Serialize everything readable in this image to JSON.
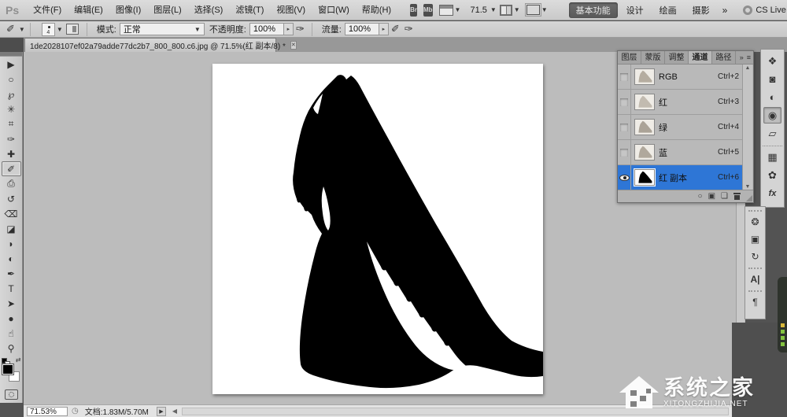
{
  "app": {
    "logo": "Ps",
    "menus": [
      "文件(F)",
      "编辑(E)",
      "图像(I)",
      "图层(L)",
      "选择(S)",
      "滤镜(T)",
      "视图(V)",
      "窗口(W)",
      "帮助(H)"
    ],
    "br_button": "Br",
    "mb_button": "Mb",
    "zoom_level": "71.5",
    "caret": "▼",
    "workspaces": [
      "基本功能",
      "设计",
      "绘画",
      "摄影"
    ],
    "workspace_more": "»",
    "cs_live": "CS Live",
    "window": {
      "minimize": "—",
      "restore": "❐",
      "close": "✕"
    }
  },
  "options_bar": {
    "brush_icon": "✐",
    "brush_size": "4",
    "mode_label": "模式:",
    "mode_value": "正常",
    "opacity_label": "不透明度:",
    "opacity_value": "100%",
    "spin": "▸",
    "airbrush_icon": "✐",
    "flow_label": "流量:",
    "flow_value": "100%",
    "pressure_icon": "✑"
  },
  "document": {
    "tab_title": "1de2028107ef02a79adde77dc2b7_800_800.c6.jpg @ 71.5%(红 副本/8) *",
    "tab_close": "✕"
  },
  "tools": [
    {
      "name": "move-tool",
      "glyph": "▶"
    },
    {
      "name": "marquee-tool",
      "glyph": "○"
    },
    {
      "name": "lasso-tool",
      "glyph": "℘"
    },
    {
      "name": "quick-selection-tool",
      "glyph": "✳"
    },
    {
      "name": "crop-tool",
      "glyph": "⌗"
    },
    {
      "name": "eyedropper-tool",
      "glyph": "✑"
    },
    {
      "name": "healing-brush-tool",
      "glyph": "✚"
    },
    {
      "name": "brush-tool",
      "glyph": "✐"
    },
    {
      "name": "clone-stamp-tool",
      "glyph": "⎙"
    },
    {
      "name": "history-brush-tool",
      "glyph": "↺"
    },
    {
      "name": "eraser-tool",
      "glyph": "⌫"
    },
    {
      "name": "gradient-tool",
      "glyph": "◪"
    },
    {
      "name": "blur-tool",
      "glyph": "◗"
    },
    {
      "name": "dodge-tool",
      "glyph": "◐"
    },
    {
      "name": "pen-tool",
      "glyph": "✒"
    },
    {
      "name": "type-tool",
      "glyph": "T"
    },
    {
      "name": "path-selection-tool",
      "glyph": "➤"
    },
    {
      "name": "shape-tool",
      "glyph": "●"
    },
    {
      "name": "hand-tool",
      "glyph": "☝"
    },
    {
      "name": "zoom-tool",
      "glyph": "⚲"
    }
  ],
  "panel": {
    "tabs": [
      "图层",
      "蒙版",
      "调整",
      "通道",
      "路径"
    ],
    "more": "»",
    "menu": "≡",
    "scroll_up": "▲",
    "scroll_down": "▼",
    "buttons": {
      "load_selection": "○",
      "save_selection": "▣",
      "new_channel": "❏"
    }
  },
  "channels": [
    {
      "label": "RGB",
      "shortcut": "Ctrl+2"
    },
    {
      "label": "红",
      "shortcut": "Ctrl+3"
    },
    {
      "label": "绿",
      "shortcut": "Ctrl+4"
    },
    {
      "label": "蓝",
      "shortcut": "Ctrl+5"
    },
    {
      "label": "红 副本",
      "shortcut": "Ctrl+6"
    }
  ],
  "right_strip": [
    {
      "name": "layers-panel-icon",
      "glyph": "❖"
    },
    {
      "name": "masks-panel-icon",
      "glyph": "◙"
    },
    {
      "name": "adjustments-panel-icon",
      "glyph": "◐"
    },
    {
      "name": "styles-panel-icon",
      "glyph": "◉"
    },
    {
      "name": "transform-panel-icon",
      "glyph": "▱"
    },
    {
      "name": "swatches-panel-icon",
      "glyph": "▦"
    },
    {
      "name": "color-panel-icon",
      "glyph": "✿"
    },
    {
      "name": "effects-panel-icon",
      "glyph": "fx"
    }
  ],
  "lower_dock": [
    {
      "name": "clone-source-panel-icon",
      "glyph": "❂"
    },
    {
      "name": "navigator-panel-icon",
      "glyph": "▣"
    },
    {
      "name": "rotate-view-panel-icon",
      "glyph": "↻"
    },
    {
      "name": "character-panel-icon",
      "glyph": "A|"
    },
    {
      "name": "paragraph-panel-icon",
      "glyph": "¶"
    }
  ],
  "status": {
    "zoom": "71.53%",
    "clock": "◷",
    "doc_size": "文档:1.83M/5.70M",
    "more": "▶",
    "left_arrow": "◀"
  },
  "watermark": {
    "title": "系统之家",
    "url": "XITONGZHIJIA.NET"
  },
  "colors": {
    "selection_blue": "#2e76d6",
    "silhouette": "#000000",
    "canvas": "#ffffff"
  }
}
